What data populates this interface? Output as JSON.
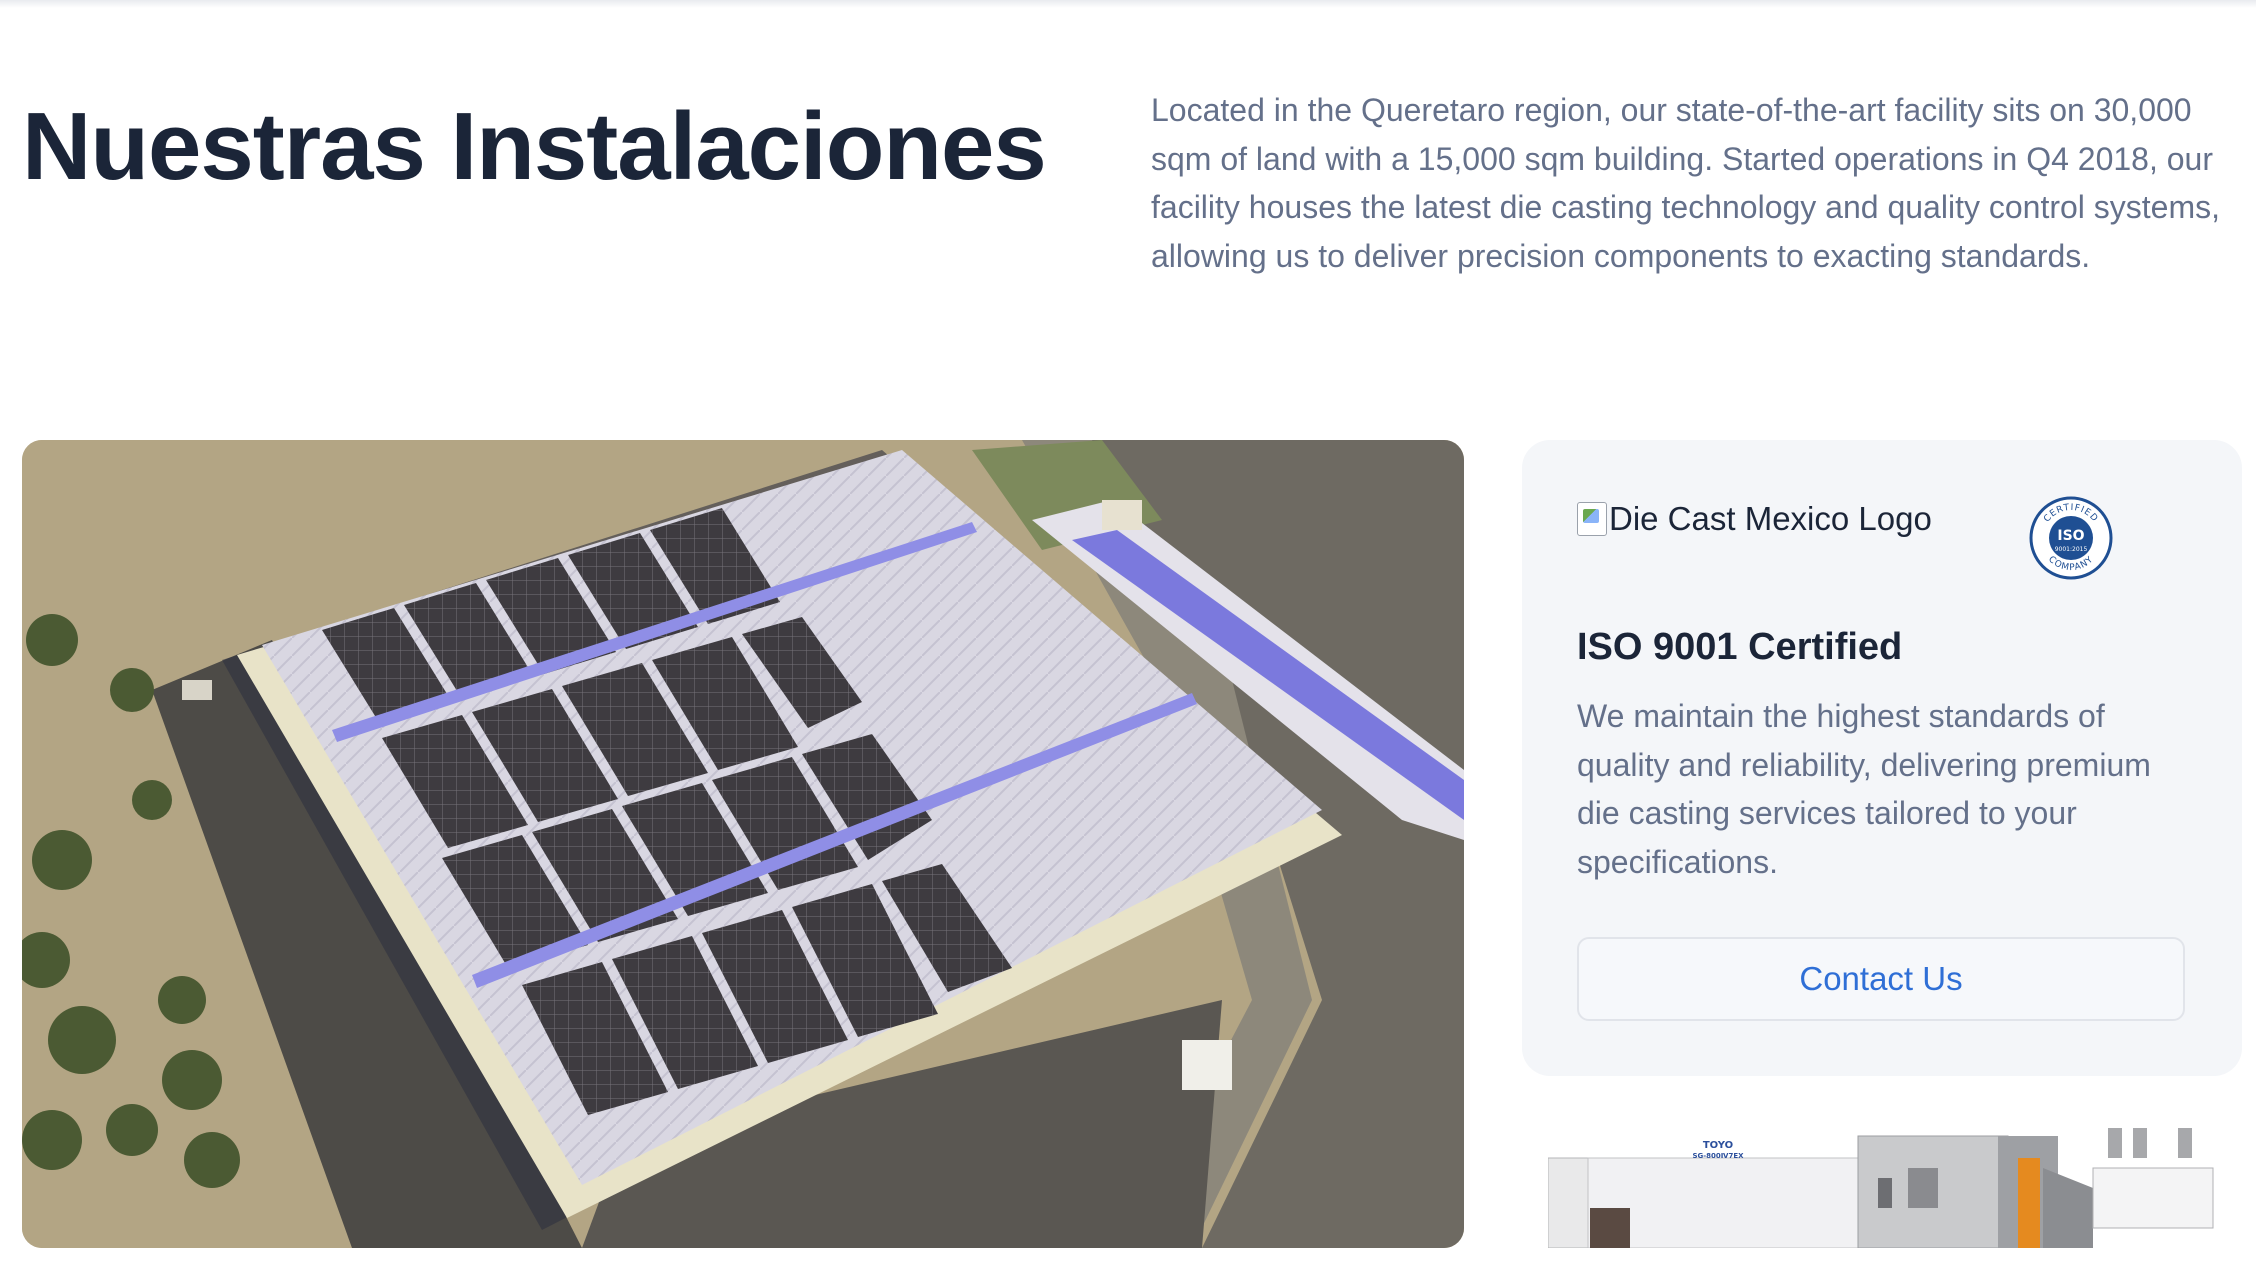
{
  "header": {
    "title": "Nuestras Instalaciones",
    "description": "Located in the Queretaro region, our state-of-the-art facility sits on 30,000 sqm of land with a 15,000 sqm building. Started operations in Q4 2018, our facility houses the latest die casting technology and quality control systems, allowing us to deliver precision components to exacting standards."
  },
  "cert_card": {
    "logo_alt": "Die Cast Mexico Logo",
    "badge": {
      "top_text": "CERTIFIED",
      "main_text": "ISO",
      "code": "9001:2015",
      "bottom_text": "COMPANY"
    },
    "title": "ISO 9001 Certified",
    "text": "We maintain the highest standards of quality and reliability, delivering premium die casting services tailored to your specifications.",
    "contact_label": "Contact Us"
  },
  "machine": {
    "brand": "TOYO",
    "model": "SG-800Ⅳ7EX"
  },
  "colors": {
    "heading": "#1b2538",
    "body_text": "#64708a",
    "link_blue": "#2f6fd6",
    "card_bg": "#f4f6f9",
    "badge_blue": "#1f4f93"
  }
}
